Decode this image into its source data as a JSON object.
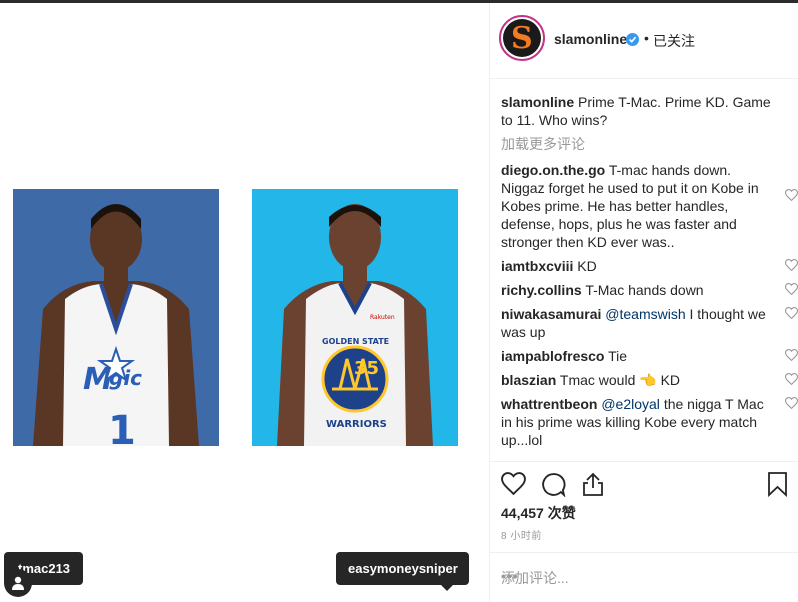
{
  "post": {
    "author": "slamonline",
    "follow_status": "已关注",
    "separator": "•",
    "caption": "Prime T-Mac. Prime KD. Game to 11. Who wins?",
    "load_more": "加载更多评论",
    "likes": "44,457 次赞",
    "time_ago": "8 小时前",
    "add_comment_placeholder": "添加评论...",
    "more_label": "•••"
  },
  "media": {
    "tags": [
      {
        "label": "tmac213"
      },
      {
        "label": "easymoneysniper"
      }
    ],
    "left_jersey": {
      "team": "Magic",
      "number": "1"
    },
    "right_jersey": {
      "team": "GOLDEN STATE WARRIORS",
      "number": "35",
      "sponsor": "Rakuten"
    }
  },
  "comments": [
    {
      "user": "diego.on.the.go",
      "text": "T-mac hands down. Niggaz forget he used to put it on Kobe in Kobes prime. He has better handles, defense, hops, plus he was faster and stronger then KD ever was.."
    },
    {
      "user": "iamtbxcviii",
      "text": "KD"
    },
    {
      "user": "richy.collins",
      "text": "T-Mac hands down"
    },
    {
      "user": "niwakasamurai",
      "mention": "@teamswish",
      "text": "I thought we was up"
    },
    {
      "user": "iampablofresco",
      "text": "Tie"
    },
    {
      "user": "blaszian",
      "text": "Tmac would 👈 KD"
    },
    {
      "user": "whattrentbeon",
      "mention": "@e2loyal",
      "text": "the nigga T Mac in his prime was killing Kobe every match up...lol"
    }
  ],
  "icons": {
    "heart": "heart-icon",
    "comment": "comment-icon",
    "share": "share-icon",
    "bookmark": "bookmark-icon",
    "verified": "verified-badge-icon",
    "user_tag": "user-tag-icon"
  },
  "colors": {
    "verified": "#3897f0",
    "mention": "#003569",
    "muted": "#999999",
    "left_bg": "#3e6aa8",
    "right_bg": "#23b6e8"
  }
}
